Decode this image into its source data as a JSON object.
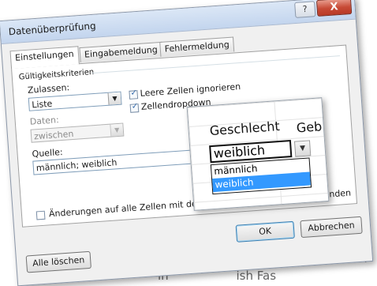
{
  "background_text": {
    "right_fragment": "n",
    "bottom_fragment": "in                  ish Fas"
  },
  "dialog": {
    "title": "Datenüberprüfung",
    "help_label": "?",
    "close_label": "X",
    "tabs": [
      {
        "label": "Einstellungen",
        "active": true
      },
      {
        "label": "Eingabemeldung",
        "active": false
      },
      {
        "label": "Fehlermeldung",
        "active": false
      }
    ],
    "group_label": "Gültigkeitskriterien",
    "allow_label": "Zulassen:",
    "allow_value": "Liste",
    "ignore_blank_label": "Leere Zellen ignorieren",
    "ignore_blank_checked": true,
    "dropdown_label": "Zellendropdown",
    "dropdown_checked": true,
    "data_label": "Daten:",
    "data_value": "zwischen",
    "source_label": "Quelle:",
    "source_value": "männlich; weiblich",
    "apply_all_label": "Änderungen auf alle Zellen mit den gleichen Einstellungen anwenden",
    "apply_all_checked": false,
    "clear_all_label": "Alle löschen",
    "ok_label": "OK",
    "cancel_label": "Abbrechen"
  },
  "overlay": {
    "header1": "Geschlecht",
    "header2": "Geb",
    "cell_value": "weiblich",
    "dropdown_arrow": "▼",
    "options": [
      "männlich",
      "weiblich"
    ],
    "selected_option": "weiblich"
  },
  "colors": {
    "selection": "#3399ff",
    "close_button": "#c74a36",
    "dialog_bg": "#f0f0f0"
  }
}
